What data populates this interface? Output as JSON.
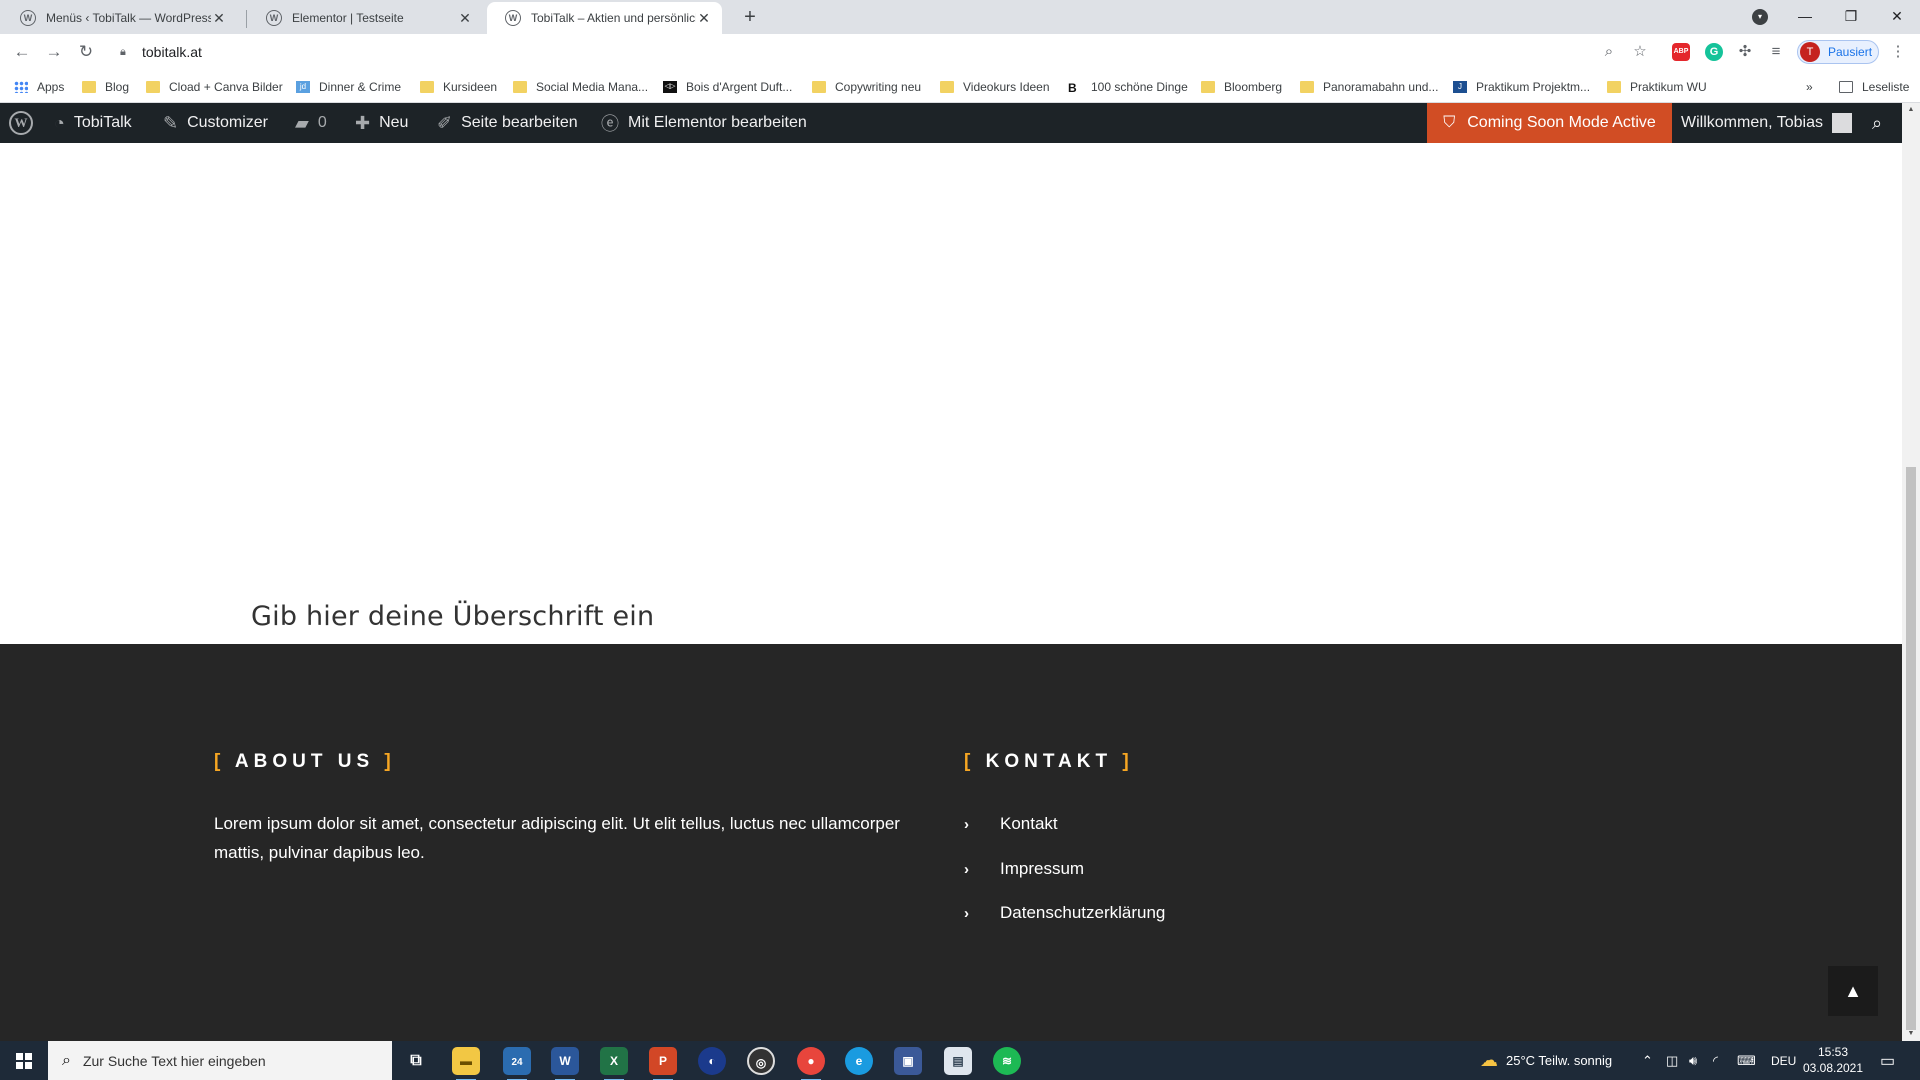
{
  "browser": {
    "tabs": [
      {
        "title": "Menüs ‹ TobiTalk — WordPress",
        "icon": "wordpress-icon",
        "active": false
      },
      {
        "title": "Elementor | Testseite",
        "icon": "wordpress-icon",
        "active": false
      },
      {
        "title": "TobiTalk – Aktien und persönlich",
        "icon": "wordpress-icon",
        "active": true
      }
    ],
    "url": "tobitalk.at",
    "profile_initial": "T",
    "profile_label": "Pausiert",
    "extension_abp": "ABP",
    "extension_grammarly": "G",
    "bookmarks": [
      {
        "label": "Apps",
        "icon": "apps"
      },
      {
        "label": "Blog",
        "icon": "folder"
      },
      {
        "label": "Cload + Canva Bilder",
        "icon": "folder"
      },
      {
        "label": "Dinner & Crime",
        "icon": "jd",
        "glyph": "jd"
      },
      {
        "label": "Kursideen",
        "icon": "folder"
      },
      {
        "label": "Social Media Mana...",
        "icon": "folder"
      },
      {
        "label": "Bois d'Argent Duft...",
        "icon": "ba",
        "glyph": "◁▷"
      },
      {
        "label": "Copywriting neu",
        "icon": "folder"
      },
      {
        "label": "Videokurs Ideen",
        "icon": "folder"
      },
      {
        "label": "100 schöne Dinge",
        "icon": "bb",
        "glyph": "B"
      },
      {
        "label": "Bloomberg",
        "icon": "folder"
      },
      {
        "label": "Panoramabahn und...",
        "icon": "folder"
      },
      {
        "label": "Praktikum Projektm...",
        "icon": "jj",
        "glyph": "J"
      },
      {
        "label": "Praktikum WU",
        "icon": "folder"
      }
    ],
    "overflow": "»",
    "reading_list": "Leseliste"
  },
  "adminbar": {
    "site_name": "TobiTalk",
    "customizer": "Customizer",
    "comments_count": "0",
    "new": "Neu",
    "edit_page": "Seite bearbeiten",
    "edit_elementor": "Mit Elementor bearbeiten",
    "coming_soon": "Coming Soon Mode Active",
    "greeting": "Willkommen, Tobias"
  },
  "page": {
    "heading": "Gib hier deine Überschrift ein"
  },
  "footer": {
    "about_title": "ABOUT US",
    "about_text": "Lorem ipsum dolor sit amet, consectetur adipiscing elit. Ut elit tellus, luctus nec ullamcorper mattis, pulvinar dapibus leo.",
    "contact_title": "KONTAKT",
    "links": [
      "Kontakt",
      "Impressum",
      "Datenschutzerklärung"
    ],
    "accent_color": "#f6a623"
  },
  "taskbar": {
    "search_placeholder": "Zur Suche Text hier eingeben",
    "mail_badge": "24",
    "apps": [
      {
        "name": "word",
        "glyph": "W"
      },
      {
        "name": "excel",
        "glyph": "X"
      },
      {
        "name": "powerpoint",
        "glyph": "P"
      }
    ],
    "weather": "25°C  Teilw. sonnig",
    "language": "DEU",
    "time": "15:53",
    "date": "03.08.2021"
  }
}
